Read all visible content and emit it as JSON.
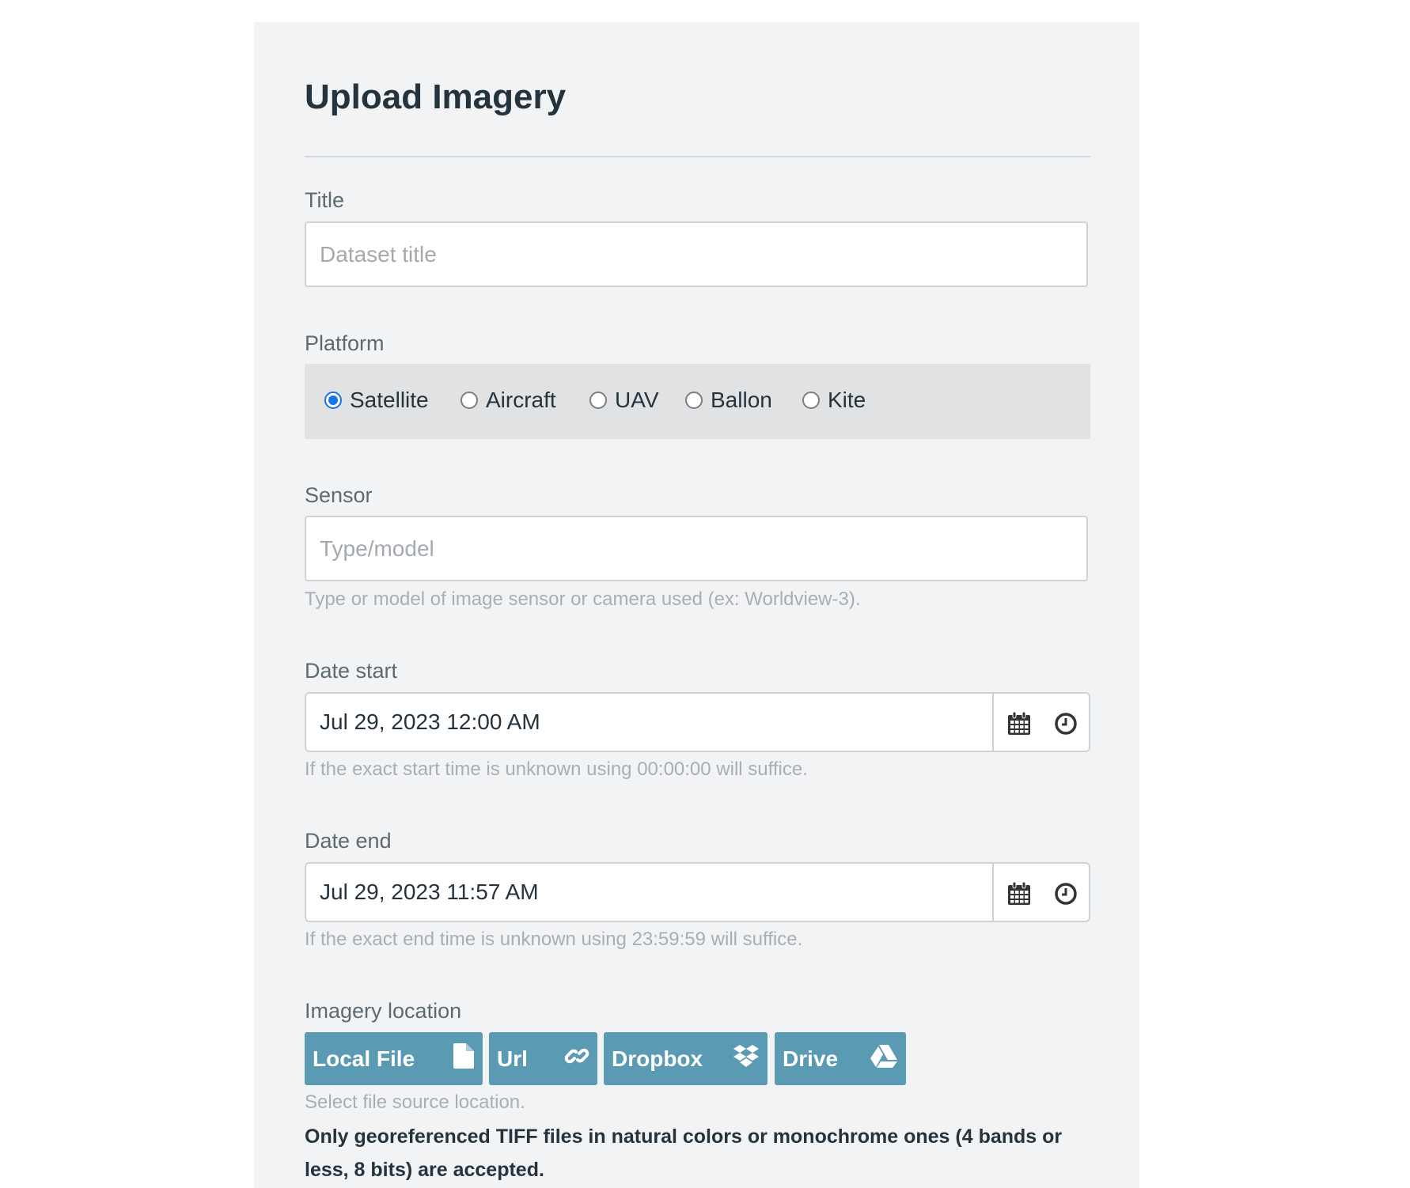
{
  "heading": "Upload Imagery",
  "title": {
    "label": "Title",
    "placeholder": "Dataset title",
    "value": ""
  },
  "platform": {
    "label": "Platform",
    "options": [
      "Satellite",
      "Aircraft",
      "UAV",
      "Ballon",
      "Kite"
    ],
    "selected": "Satellite"
  },
  "sensor": {
    "label": "Sensor",
    "placeholder": "Type/model",
    "help": "Type or model of image sensor or camera used (ex: Worldview-3)."
  },
  "date_start": {
    "label": "Date start",
    "value": "Jul 29, 2023 12:00 AM",
    "help": "If the exact start time is unknown using 00:00:00 will suffice."
  },
  "date_end": {
    "label": "Date end",
    "value": "Jul 29, 2023 11:57 AM",
    "help": "If the exact end time is unknown using 23:59:59 will suffice."
  },
  "location": {
    "label": "Imagery location",
    "buttons": [
      {
        "label": "Local File",
        "icon": "file-icon"
      },
      {
        "label": "Url",
        "icon": "link-icon"
      },
      {
        "label": "Dropbox",
        "icon": "dropbox-icon"
      },
      {
        "label": "Drive",
        "icon": "drive-icon"
      }
    ],
    "help": "Select file source location.",
    "note": "Only georeferenced TIFF files in natural colors or monochrome ones (4 bands or less, 8 bits) are accepted."
  },
  "colors": {
    "accent": "#5b9ab3",
    "radio": "#1a73e8",
    "panel": "#f2f3f5"
  }
}
